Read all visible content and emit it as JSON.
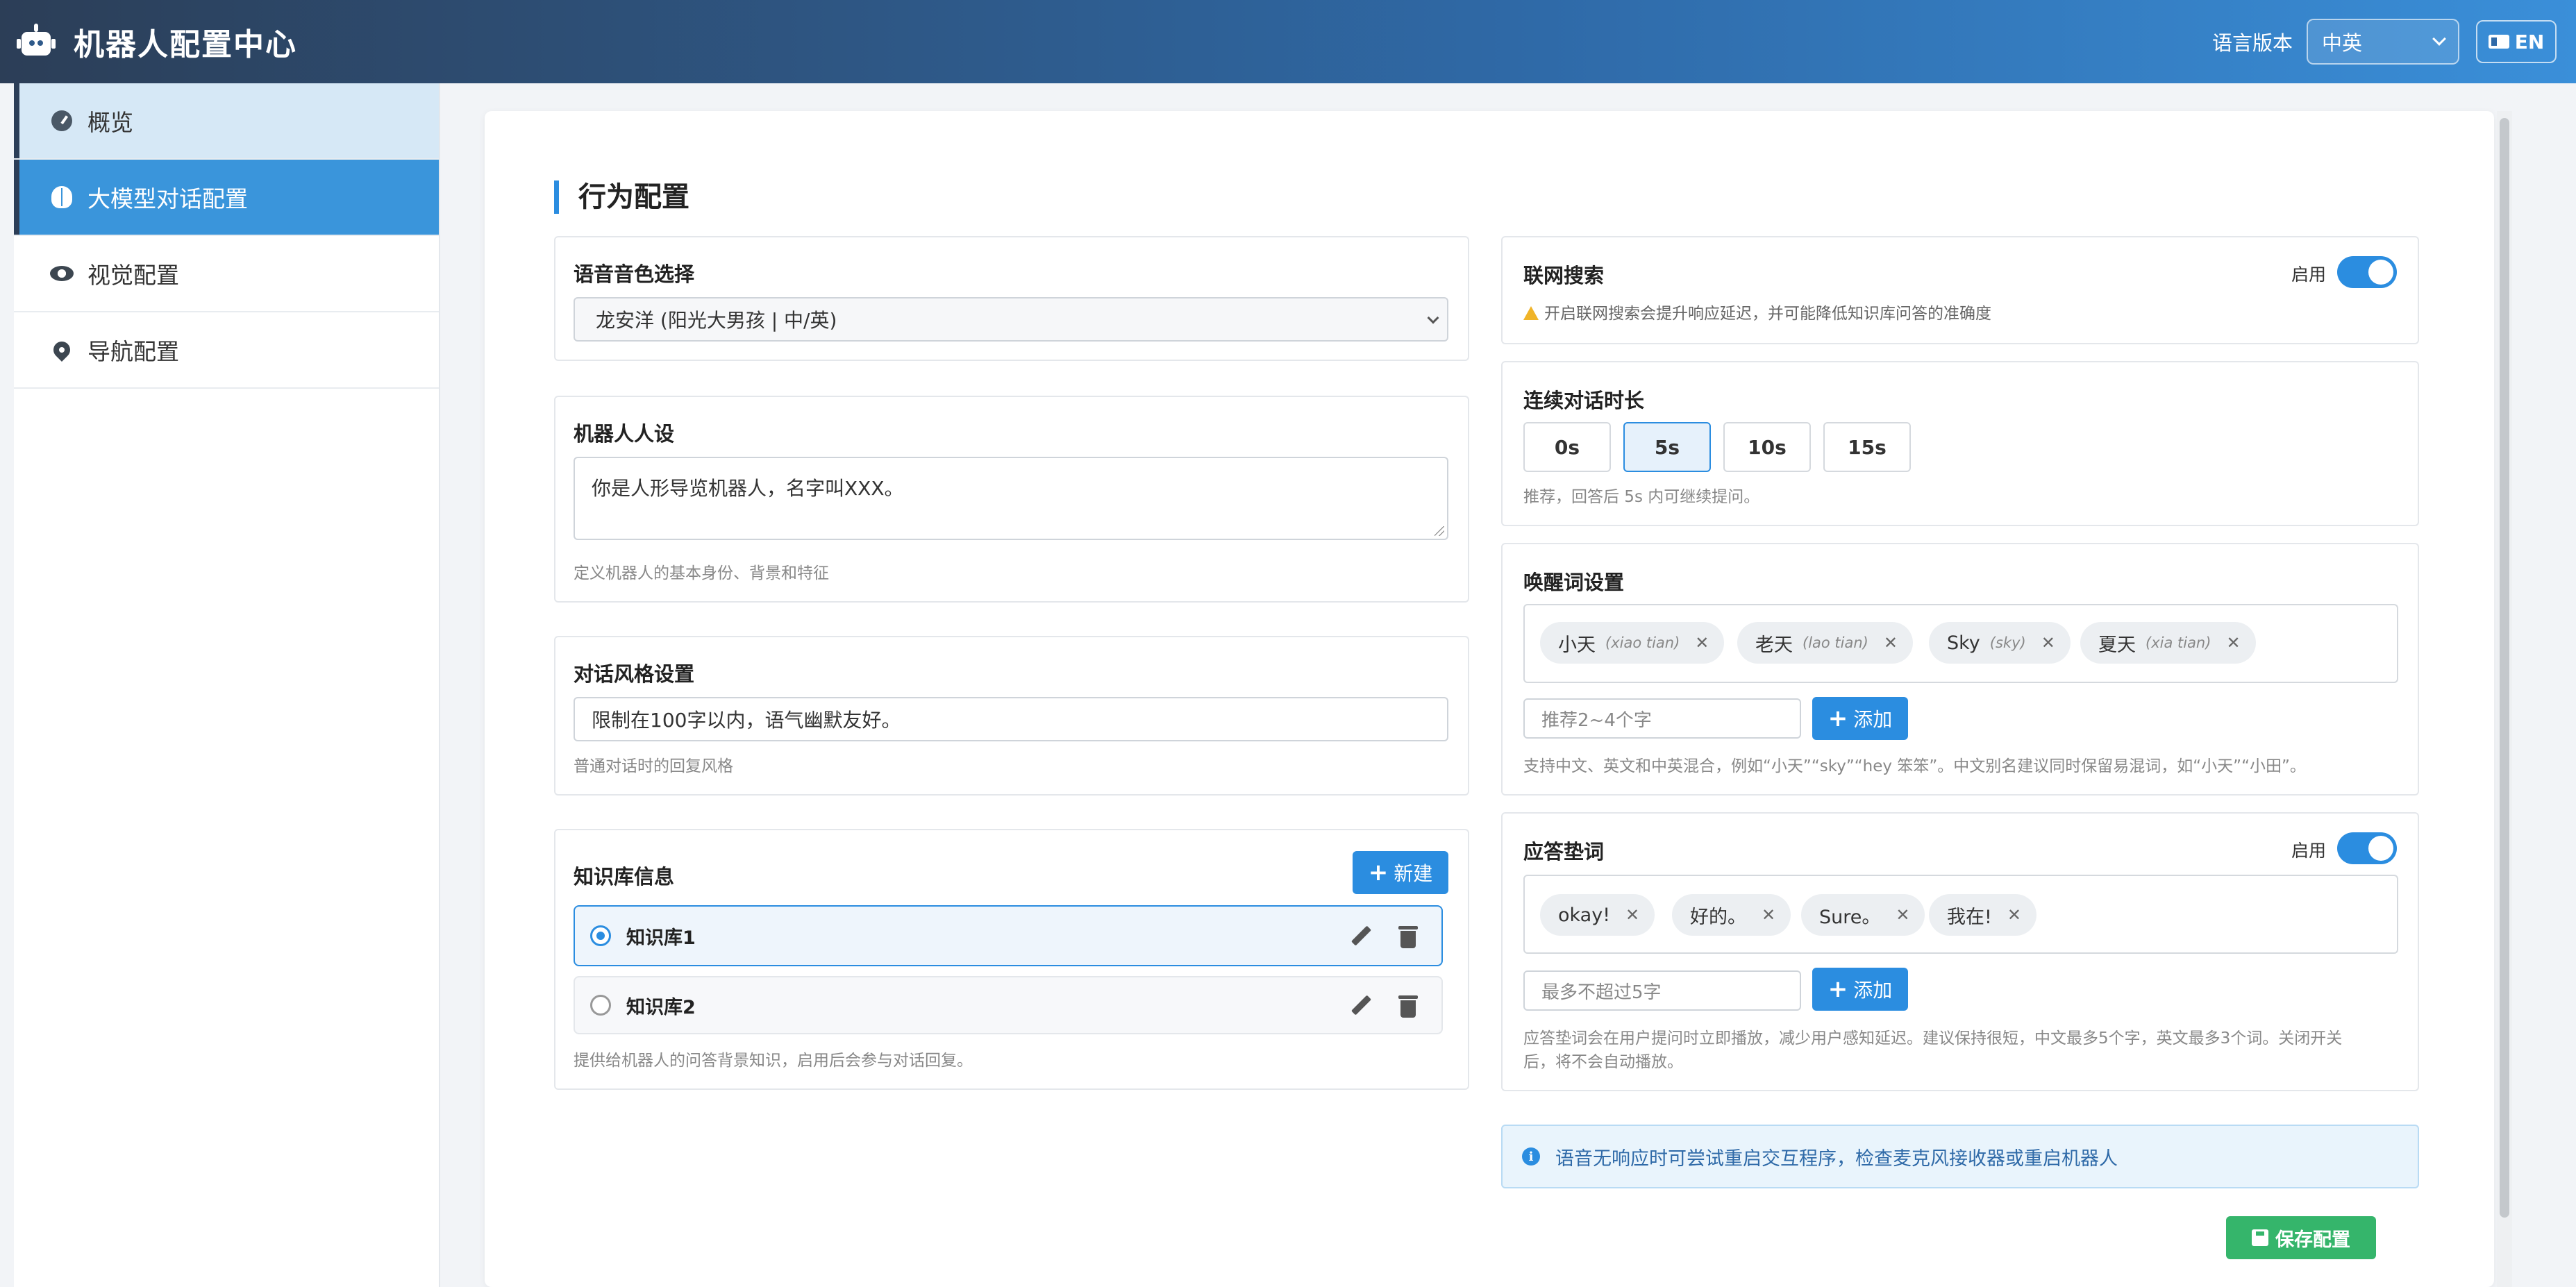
{
  "header": {
    "title": "机器人配置中心",
    "lang_label": "语言版本",
    "lang_value": "中英",
    "lang_button": "EN"
  },
  "sidebar": {
    "items": [
      {
        "label": "概览",
        "icon": "dashboard-icon"
      },
      {
        "label": "大模型对话配置",
        "icon": "brain-icon",
        "active": true
      },
      {
        "label": "视觉配置",
        "icon": "eye-icon"
      },
      {
        "label": "导航配置",
        "icon": "location-pin-icon"
      }
    ]
  },
  "main": {
    "section_title": "行为配置",
    "voice": {
      "label": "语音音色选择",
      "value": "龙安洋 (阳光大男孩 | 中/英)"
    },
    "persona": {
      "label": "机器人人设",
      "value": "你是人形导览机器人，名字叫XXX。",
      "hint": "定义机器人的基本身份、背景和特征"
    },
    "style": {
      "label": "对话风格设置",
      "value": "限制在100字以内，语气幽默友好。",
      "hint": "普通对话时的回复风格"
    },
    "kb": {
      "label": "知识库信息",
      "new_button": "新建",
      "items": [
        {
          "name": "知识库1",
          "selected": true
        },
        {
          "name": "知识库2",
          "selected": false
        }
      ],
      "hint": "提供给机器人的问答背景知识，启用后会参与对话回复。"
    },
    "web_search": {
      "label": "联网搜索",
      "toggle_label": "启用",
      "enabled": true,
      "warning": "开启联网搜索会提升响应延迟，并可能降低知识库问答的准确度"
    },
    "duration": {
      "label": "连续对话时长",
      "options": [
        "0s",
        "5s",
        "10s",
        "15s"
      ],
      "selected": "5s",
      "hint": "推荐，回答后 5s 内可继续提问。"
    },
    "wake": {
      "label": "唤醒词设置",
      "tags": [
        {
          "text": "小天",
          "pinyin": "(xiao tian)"
        },
        {
          "text": "老天",
          "pinyin": "(lao tian)"
        },
        {
          "text": "Sky",
          "pinyin": "(sky)"
        },
        {
          "text": "夏天",
          "pinyin": "(xia tian)"
        }
      ],
      "placeholder": "推荐2~4个字",
      "add_button": "添加",
      "hint": "支持中文、英文和中英混合，例如“小天”“sky”“hey 笨笨”。中文别名建议同时保留易混词，如“小天”“小田”。"
    },
    "filler": {
      "label": "应答垫词",
      "toggle_label": "启用",
      "enabled": true,
      "tags": [
        "okay!",
        "好的。",
        "Sure。",
        "我在!"
      ],
      "placeholder": "最多不超过5字",
      "add_button": "添加",
      "hint_line1": "应答垫词会在用户提问时立即播放，减少用户感知延迟。建议保持很短，中文最多5个字，英文最多3个词。关闭开关",
      "hint_line2": "后，将不会自动播放。"
    },
    "info": "语音无响应时可尝试重启交互程序，检查麦克风接收器或重启机器人",
    "save_button": "保存配置"
  },
  "colors": {
    "accent": "#2b8de0",
    "save": "#35b56b",
    "header_start": "#2c3e57",
    "header_end": "#3a8fd9"
  }
}
